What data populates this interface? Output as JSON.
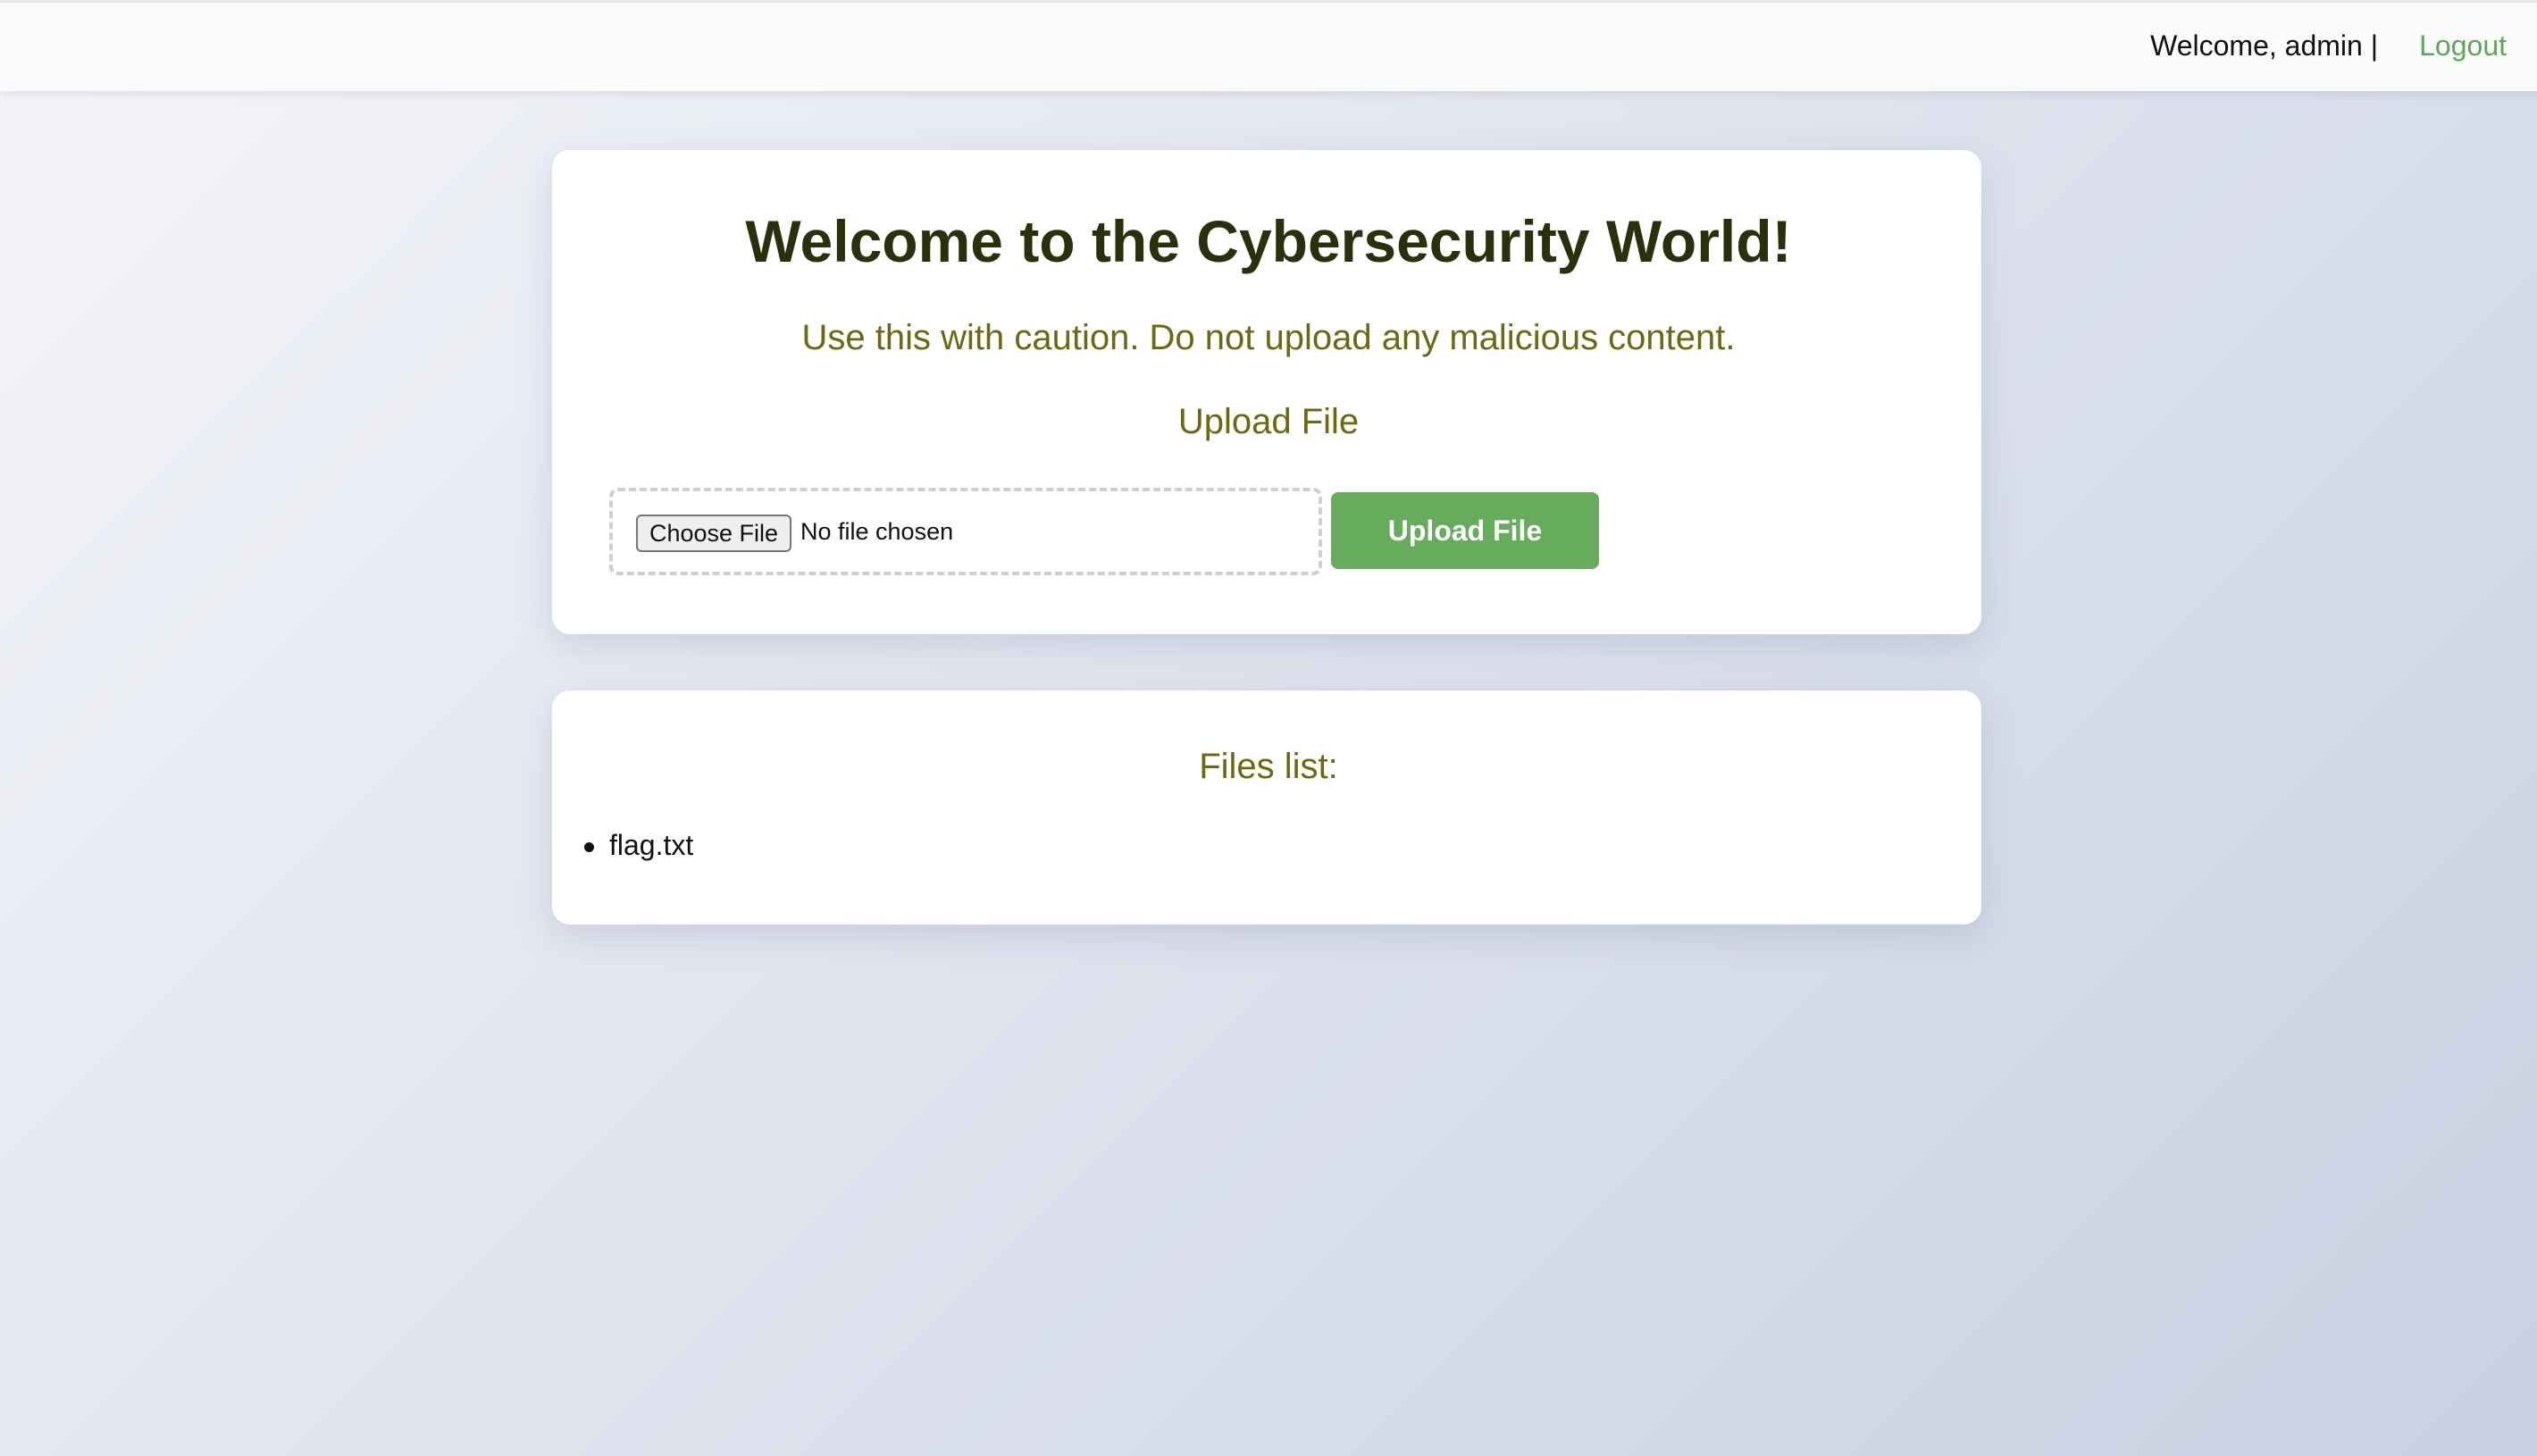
{
  "header": {
    "welcome_text": "Welcome, admin |",
    "logout_label": "Logout"
  },
  "upload_card": {
    "title": "Welcome to the Cybersecurity World!",
    "subtitle": "Use this with caution. Do not upload any malicious content.",
    "section_heading": "Upload File",
    "choose_file_label": "Choose File",
    "file_status": "No file chosen",
    "upload_button_label": "Upload File"
  },
  "files_card": {
    "heading": "Files list:",
    "files": [
      "flag.txt"
    ]
  },
  "colors": {
    "accent_green": "#67ab5d",
    "title_color": "#2b2f0a",
    "olive_text": "#6b6a10"
  }
}
